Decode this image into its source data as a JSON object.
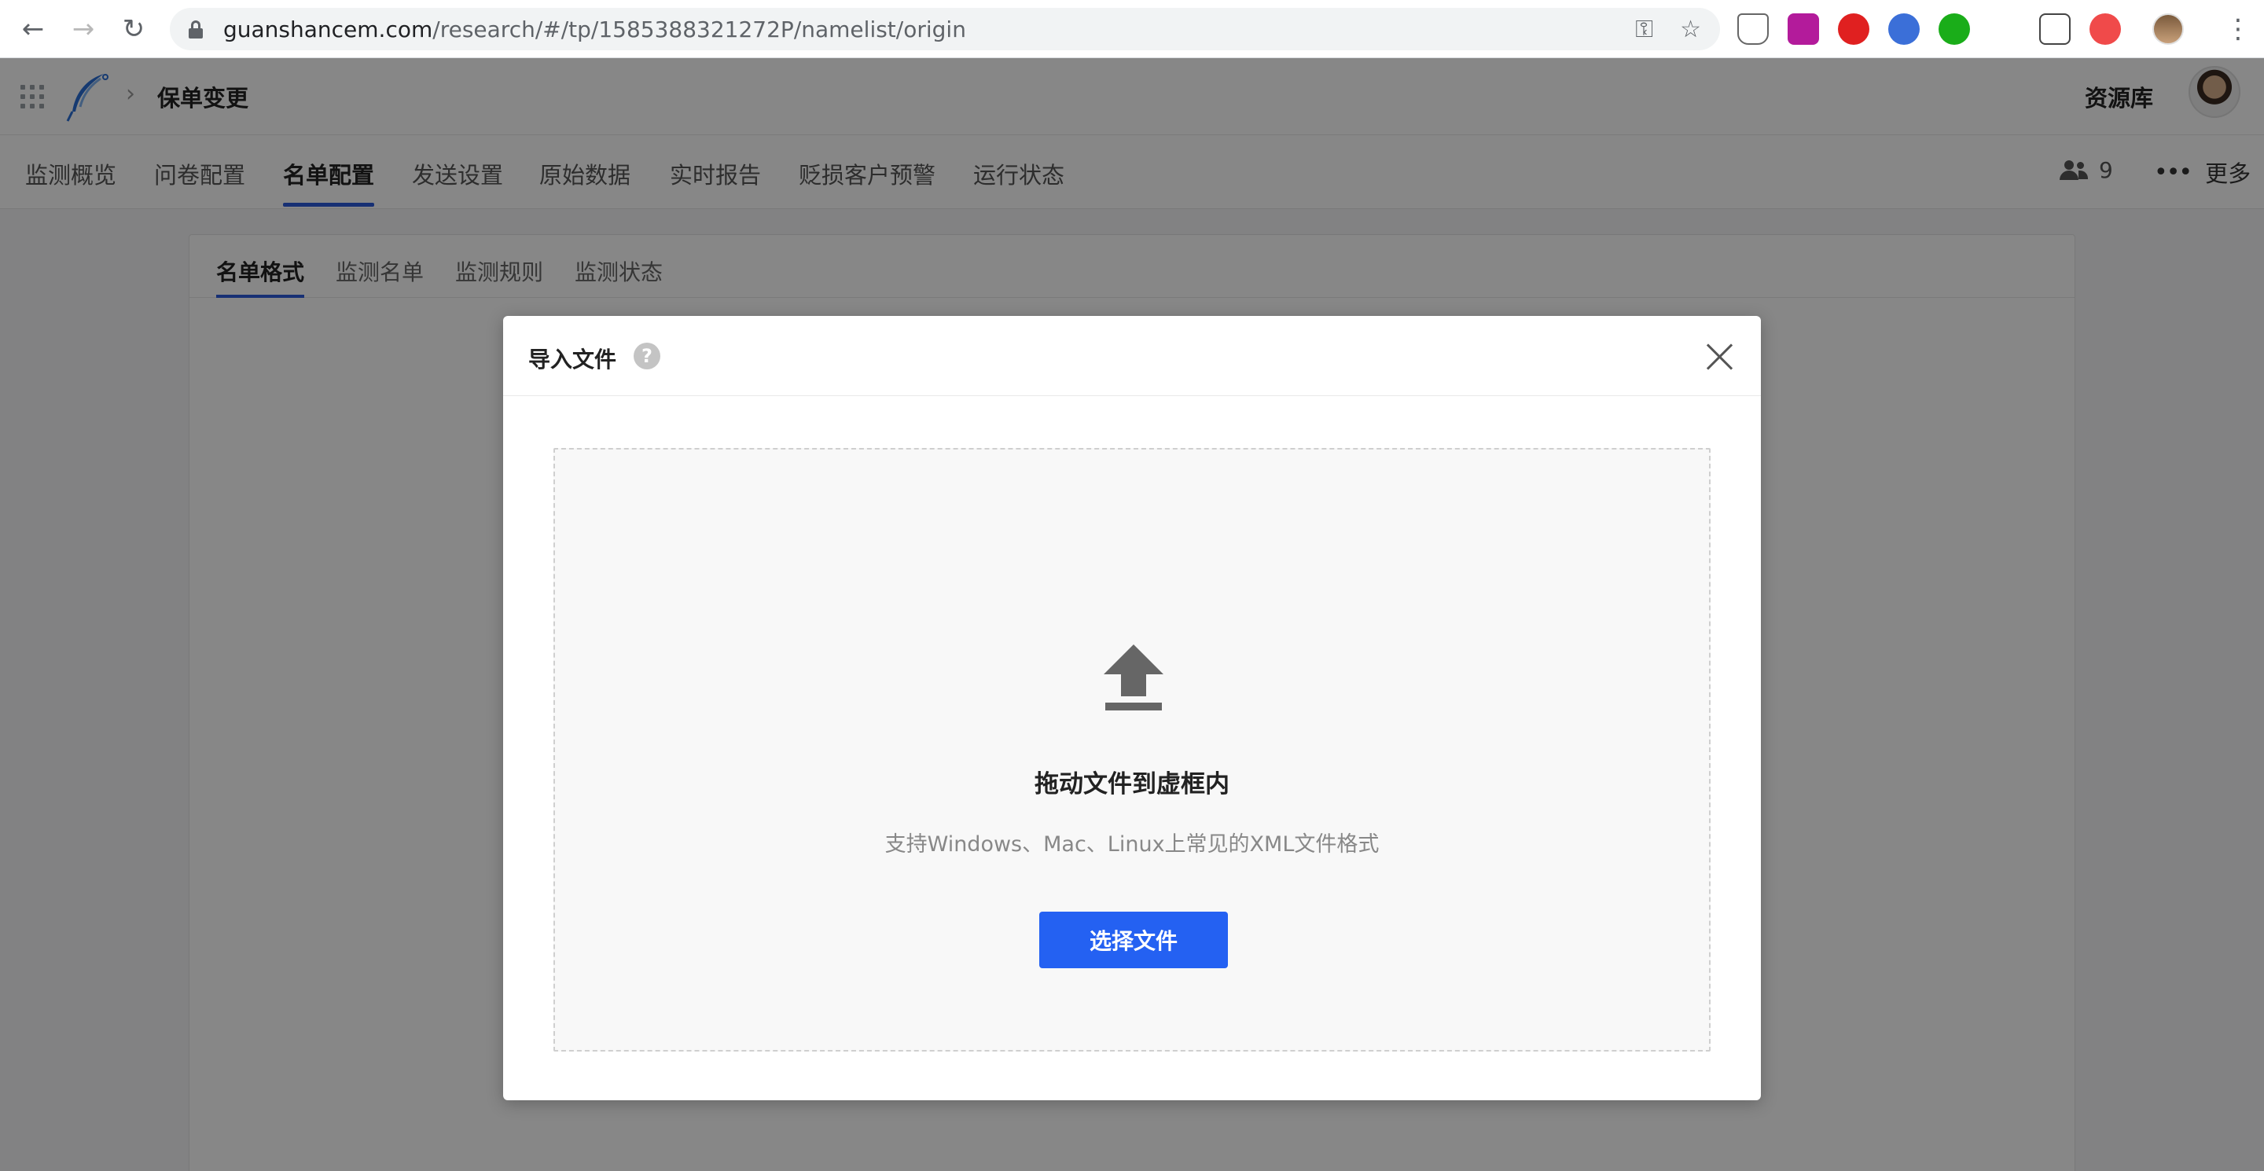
{
  "browser": {
    "url_host": "guanshancem.com",
    "url_path": "/research/#/tp/1585388321272P/namelist/origin"
  },
  "header": {
    "project_title": "保单变更",
    "resource_library": "资源库"
  },
  "main_tabs": [
    {
      "label": "监测概览"
    },
    {
      "label": "问卷配置"
    },
    {
      "label": "名单配置",
      "active": true
    },
    {
      "label": "发送设置"
    },
    {
      "label": "原始数据"
    },
    {
      "label": "实时报告"
    },
    {
      "label": "贬损客户预警"
    },
    {
      "label": "运行状态"
    }
  ],
  "toolbar": {
    "member_count": "9",
    "more_label": "更多"
  },
  "sub_tabs": [
    {
      "label": "名单格式",
      "active": true
    },
    {
      "label": "监测名单"
    },
    {
      "label": "监测规则"
    },
    {
      "label": "监测状态"
    }
  ],
  "modal": {
    "title": "导入文件",
    "help_glyph": "?",
    "dropzone_title": "拖动文件到虚框内",
    "dropzone_hint": "支持Windows、Mac、Linux上常见的XML文件格式",
    "choose_button": "选择文件"
  },
  "icons": {
    "back": "arrow-left-icon",
    "forward": "arrow-right-icon",
    "reload": "reload-icon",
    "lock": "lock-icon",
    "key": "key-icon",
    "star": "star-icon",
    "apps": "grid-icon",
    "members": "people-icon",
    "more": "more-dots-icon",
    "help": "question-icon",
    "close": "close-icon",
    "upload": "upload-icon"
  },
  "colors": {
    "accent": "#2461f2",
    "tab_underline": "#2d5bdb",
    "overlay": "rgba(0,0,0,0.47)"
  }
}
